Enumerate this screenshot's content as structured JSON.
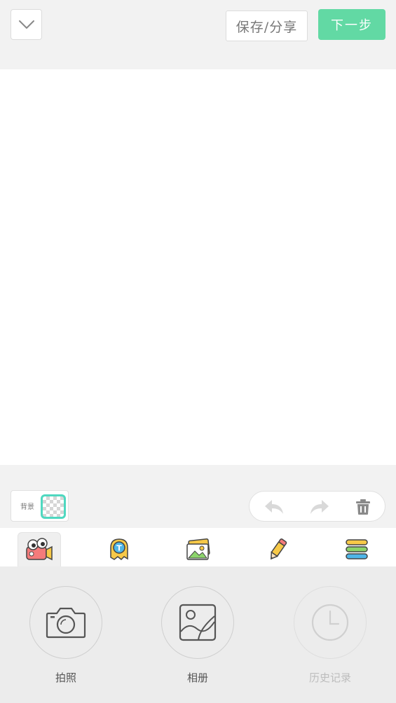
{
  "header": {
    "collapse_icon": "chevron-down-icon",
    "save_share_label": "保存/分享",
    "next_label": "下一步",
    "accent_color": "#62d9a4"
  },
  "background": {
    "label": "背景",
    "swatch": "transparent-checker",
    "border_color": "#4fd8c0"
  },
  "edit_actions": {
    "undo_icon": "undo-icon",
    "redo_icon": "redo-icon",
    "delete_icon": "trash-icon"
  },
  "tabs": [
    {
      "icon": "camera-character-icon",
      "active": true
    },
    {
      "icon": "text-sticker-icon",
      "active": false
    },
    {
      "icon": "picture-sticker-icon",
      "active": false
    },
    {
      "icon": "pencil-icon",
      "active": false
    },
    {
      "icon": "layers-icon",
      "active": false
    }
  ],
  "tools": [
    {
      "label": "拍照",
      "icon": "camera-icon",
      "enabled": true
    },
    {
      "label": "相册",
      "icon": "album-icon",
      "enabled": true
    },
    {
      "label": "历史记录",
      "icon": "clock-icon",
      "enabled": false
    }
  ]
}
